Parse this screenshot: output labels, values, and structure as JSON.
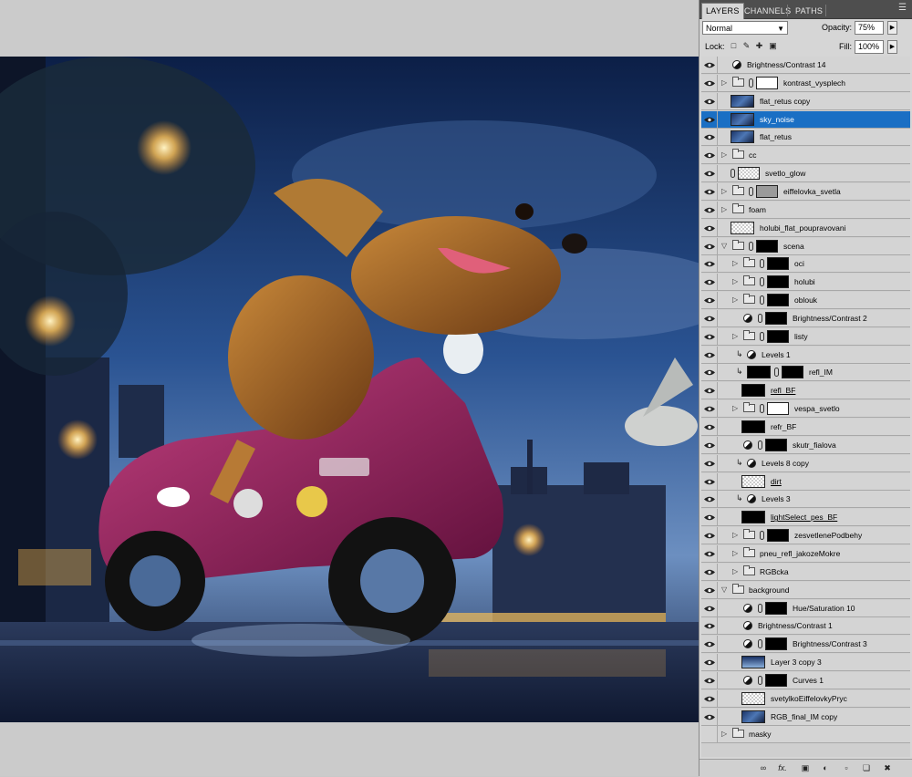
{
  "panel": {
    "tabs": [
      "LAYERS",
      "CHANNELS",
      "PATHS"
    ],
    "blend_mode": "Normal",
    "opacity_label": "Opacity:",
    "opacity_value": "75%",
    "lock_label": "Lock:",
    "fill_label": "Fill:",
    "fill_value": "100%"
  },
  "layers": [
    {
      "name": "Brightness/Contrast 14",
      "kind": "adjustment",
      "indent": 0
    },
    {
      "name": "kontrast_vysplech",
      "kind": "group",
      "indent": 0,
      "thumb": "white-mask"
    },
    {
      "name": "flat_retus copy",
      "kind": "image",
      "indent": 0,
      "thumb": "photo"
    },
    {
      "name": "sky_noise",
      "kind": "image",
      "indent": 0,
      "thumb": "photo",
      "selected": true
    },
    {
      "name": "flat_retus",
      "kind": "image",
      "indent": 0,
      "thumb": "photo"
    },
    {
      "name": "cc",
      "kind": "group",
      "indent": 0
    },
    {
      "name": "svetlo_glow",
      "kind": "layer-mask",
      "indent": 0,
      "thumb": "transparent"
    },
    {
      "name": "eiffelovka_svetla",
      "kind": "group",
      "indent": 0,
      "thumb": "gray-mask"
    },
    {
      "name": "foam",
      "kind": "group",
      "indent": 0
    },
    {
      "name": "holubi_flat_poupravovani",
      "kind": "image",
      "indent": 0,
      "thumb": "transparent"
    },
    {
      "name": "scena",
      "kind": "group-open",
      "indent": 0,
      "thumb": "black-mask"
    },
    {
      "name": "oci",
      "kind": "group",
      "indent": 1,
      "thumb": "black-mask"
    },
    {
      "name": "holubi",
      "kind": "group",
      "indent": 1,
      "thumb": "black-mask"
    },
    {
      "name": "oblouk",
      "kind": "group",
      "indent": 1,
      "thumb": "black-mask"
    },
    {
      "name": "Brightness/Contrast 2",
      "kind": "adjustment-mask",
      "indent": 1,
      "thumb": "black-mask"
    },
    {
      "name": "listy",
      "kind": "group",
      "indent": 1,
      "thumb": "black-mask"
    },
    {
      "name": "Levels 1",
      "kind": "adjustment-clip",
      "indent": 1
    },
    {
      "name": "refl_IM",
      "kind": "clip-image",
      "indent": 1,
      "thumb": "black-mask",
      "underline": false
    },
    {
      "name": "refl_BF",
      "kind": "image",
      "indent": 1,
      "thumb": "black-mask",
      "underline": true
    },
    {
      "name": "vespa_svetlo",
      "kind": "group",
      "indent": 1,
      "thumb": "white-mask"
    },
    {
      "name": "refr_BF",
      "kind": "image",
      "indent": 1,
      "thumb": "black-mask"
    },
    {
      "name": "skutr_fialova",
      "kind": "adjustment-mask",
      "indent": 1,
      "thumb": "black-mask"
    },
    {
      "name": "Levels 8 copy",
      "kind": "adjustment-clip",
      "indent": 1
    },
    {
      "name": "dirt",
      "kind": "image",
      "indent": 1,
      "thumb": "transparent",
      "underline": true
    },
    {
      "name": "Levels 3",
      "kind": "adjustment-clip",
      "indent": 1
    },
    {
      "name": "lightSelect_pes_BF",
      "kind": "image",
      "indent": 1,
      "thumb": "black-mask",
      "underline": true
    },
    {
      "name": "zesvetlenePodbehy",
      "kind": "group",
      "indent": 1,
      "thumb": "black-mask"
    },
    {
      "name": "pneu_refl_jakozeMokre",
      "kind": "group",
      "indent": 1
    },
    {
      "name": "RGBcka",
      "kind": "group",
      "indent": 1
    },
    {
      "name": "background",
      "kind": "group-open",
      "indent": 0
    },
    {
      "name": "Hue/Saturation 10",
      "kind": "adjustment-mask",
      "indent": 1,
      "thumb": "black-mask"
    },
    {
      "name": "Brightness/Contrast 1",
      "kind": "adjustment",
      "indent": 1
    },
    {
      "name": "Brightness/Contrast 3",
      "kind": "adjustment-mask",
      "indent": 1,
      "thumb": "black-mask"
    },
    {
      "name": "Layer 3 copy 3",
      "kind": "image",
      "indent": 1,
      "thumb": "sky"
    },
    {
      "name": "Curves 1",
      "kind": "adjustment-mask",
      "indent": 1,
      "thumb": "black-mask"
    },
    {
      "name": "svetylkoEiffelovkyPryc",
      "kind": "image",
      "indent": 1,
      "thumb": "transparent"
    },
    {
      "name": "RGB_final_IM copy",
      "kind": "image",
      "indent": 1,
      "thumb": "photo"
    },
    {
      "name": "masky",
      "kind": "group",
      "indent": 0,
      "hidden": true
    }
  ],
  "footer_icons": [
    "link-layers-icon",
    "fx-icon",
    "add-mask-icon",
    "adjustment-layer-icon",
    "new-group-icon",
    "new-layer-icon",
    "delete-layer-icon"
  ],
  "footer_fx": "fx.",
  "colors": {
    "selection": "#1a6fc4",
    "panel_bg": "#d6d6d6",
    "tab_bar": "#4e4e4e"
  }
}
